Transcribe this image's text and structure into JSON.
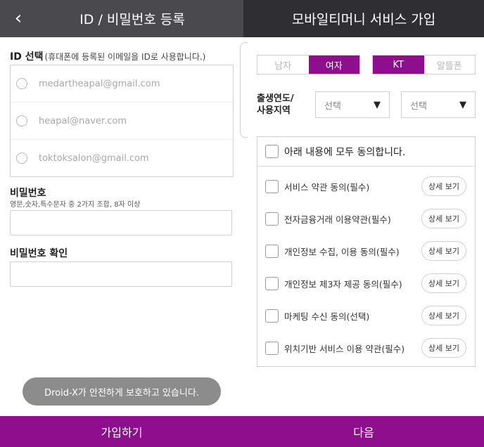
{
  "left": {
    "back_icon": "‹",
    "title": "ID / 비밀번호 등록",
    "id_label": "ID 선택",
    "id_hint": "(휴대폰에 등록된 이메일을 ID로 사용합니다.)",
    "emails": [
      "medartheapal@gmail.com",
      "heapal@naver.com",
      "toktoksalon@gmail.com"
    ],
    "password_label": "비밀번호",
    "password_hint": "영문,숫자,특수문자 중 2가지 조합, 8자 이상",
    "password_value": "",
    "password_confirm_label": "비밀번호 확인",
    "password_confirm_value": "",
    "toast": "Droid-X가 안전하게 보호하고 있습니다.",
    "footer_button": "가입하기"
  },
  "right": {
    "title": "모바일티머니 서비스 가입",
    "gender": {
      "options": [
        "남자",
        "여자"
      ],
      "selected": "여자"
    },
    "carrier": {
      "options": [
        "KT",
        "알뜰폰"
      ],
      "selected": "KT"
    },
    "birth_label_line1": "출생연도/",
    "birth_label_line2": "사용지역",
    "select_year": "선택",
    "select_region": "선택",
    "caret_icon": "▼",
    "agree_all": "아래 내용에 모두 동의합니다.",
    "agreements": [
      "서비스 약관 동의(필수)",
      "전자금융거래 이용약관(필수)",
      "개인정보 수집, 이용 동의(필수)",
      "개인정보 제3자 제공 동의(필수)",
      "마케팅 수신 동의(선택)",
      "위치기반 서비스 이용 약관(필수)"
    ],
    "detail_label": "상세 보기",
    "footer_button": "다음"
  },
  "colors": {
    "accent": "#8e0e8e",
    "left_header": "#4a4a4e",
    "right_header": "#2f2f33",
    "toast": "#8c8c8c"
  }
}
